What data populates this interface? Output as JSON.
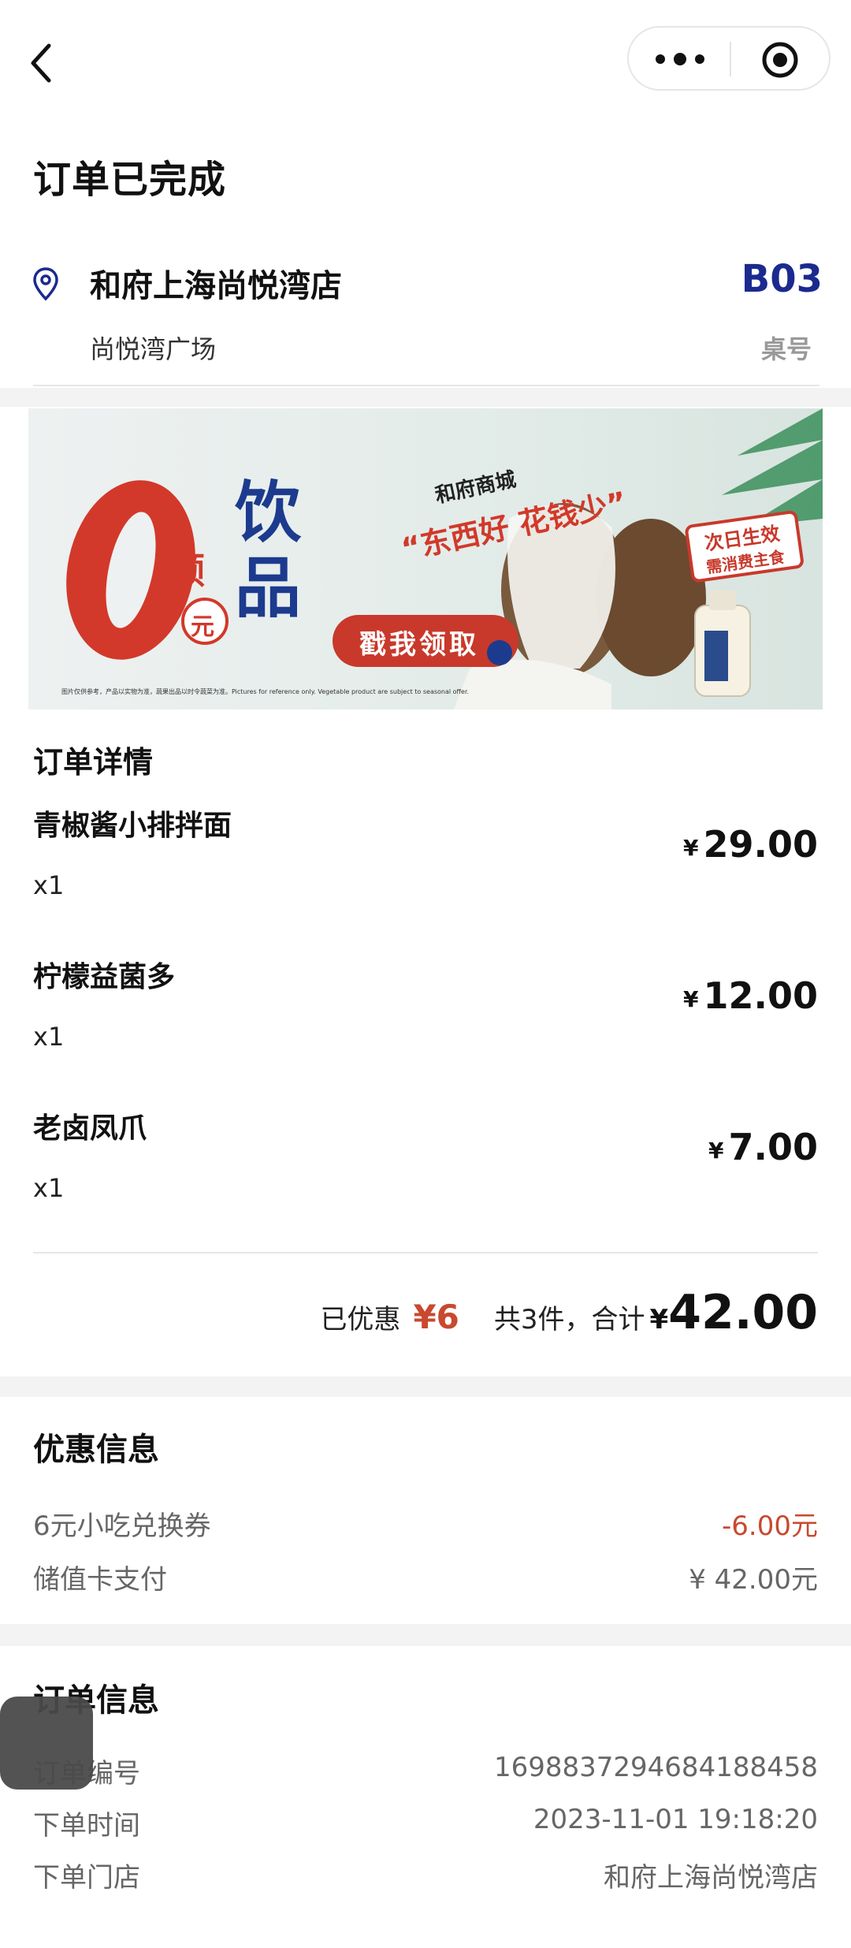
{
  "header": {
    "title": "订单已完成",
    "icons": [
      "back-icon",
      "more-dots-icon",
      "record-target-icon"
    ]
  },
  "store": {
    "name": "和府上海尚悦湾店",
    "location": "尚悦湾广场",
    "table_number": "B03",
    "table_label": "桌号"
  },
  "banner": {
    "headline_zero": "0",
    "headline_get": "领",
    "headline_yuan": "元",
    "headline_drink": "饮品",
    "mall": "和府商城",
    "slogan": "“东西好 花钱少”",
    "cta": "戳我领取",
    "stamp_line1": "次日生效",
    "stamp_line2": "需消费主食",
    "disclaimer": "图片仅供参考，产品以实物为准，蔬果出品以时令蔬菜为准。Pictures for reference only. Vegetable product are subject to seasonal offer."
  },
  "order_details": {
    "title": "订单详情",
    "currency": "¥",
    "items": [
      {
        "name": "青椒酱小排拌面",
        "qty": "x1",
        "price": "29.00"
      },
      {
        "name": "柠檬益菌多",
        "qty": "x1",
        "price": "12.00"
      },
      {
        "name": "老卤凤爪",
        "qty": "x1",
        "price": "7.00"
      }
    ],
    "summary": {
      "discount_label": "已优惠",
      "discount_value": "¥6",
      "count_label": "共3件，合计",
      "currency": "¥",
      "total": "42.00"
    }
  },
  "discount_info": {
    "title": "优惠信息",
    "rows": [
      {
        "label": "6元小吃兑换券",
        "value": "-6.00元"
      },
      {
        "label": "储值卡支付",
        "value": "¥ 42.00元"
      }
    ]
  },
  "order_info": {
    "title": "订单信息",
    "rows": [
      {
        "label": "订单编号",
        "value": "1698837294684188458"
      },
      {
        "label": "下单时间",
        "value": "2023-11-01 19:18:20"
      },
      {
        "label": "下单门店",
        "value": "和府上海尚悦湾店"
      }
    ]
  },
  "colors": {
    "accent_red": "#c8492e",
    "table_blue": "#1b2a8f",
    "banner_red": "#d2392a",
    "banner_blue": "#1c3b8e"
  }
}
